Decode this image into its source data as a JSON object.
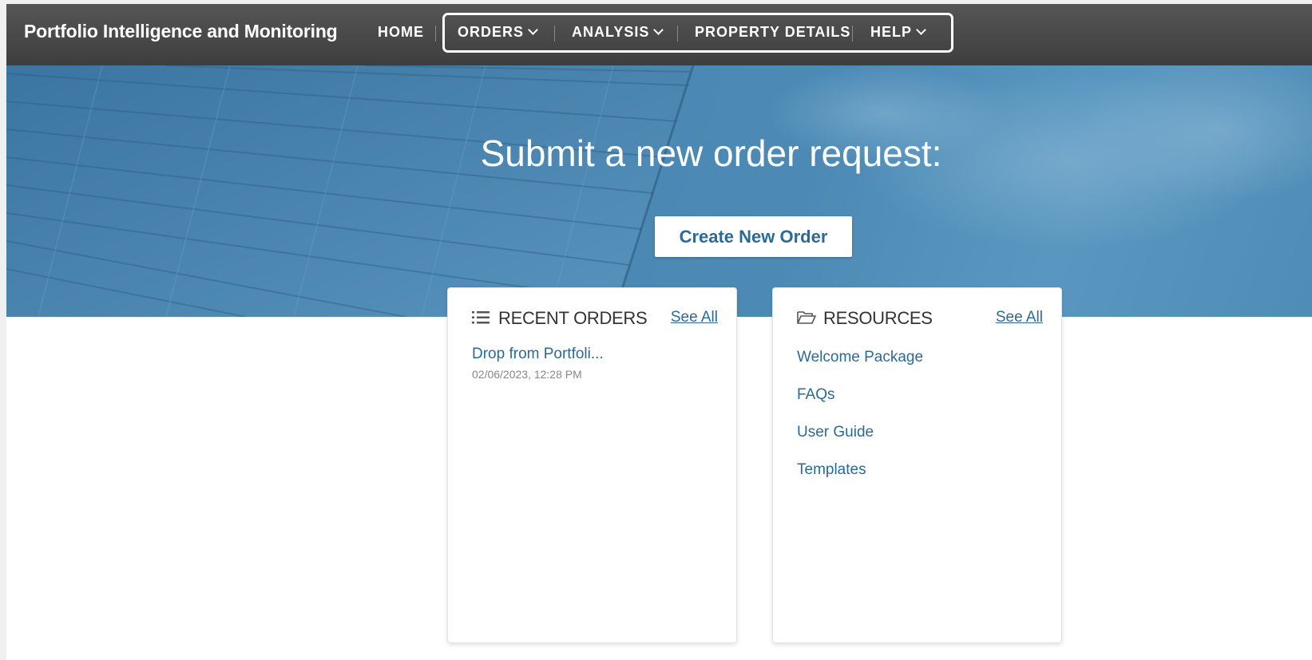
{
  "header": {
    "app_title": "Portfolio Intelligence and Monitoring",
    "home": "HOME",
    "nav": [
      {
        "label": "ORDERS",
        "dropdown": true
      },
      {
        "label": "ANALYSIS",
        "dropdown": true
      },
      {
        "label": "PROPERTY DETAILS",
        "dropdown": false
      },
      {
        "label": "HELP",
        "dropdown": true
      }
    ]
  },
  "hero": {
    "title": "Submit a new order request:",
    "button": "Create New Order"
  },
  "recent_orders": {
    "title": "RECENT ORDERS",
    "see_all": "See All",
    "items": [
      {
        "name": "Drop from Portfoli...",
        "date": "02/06/2023, 12:28 PM"
      }
    ]
  },
  "resources": {
    "title": "RESOURCES",
    "see_all": "See All",
    "items": [
      "Welcome Package",
      "FAQs",
      "User Guide",
      "Templates"
    ]
  },
  "colors": {
    "nav_bg": "#474747",
    "hero_blue": "#4a86b0",
    "link_blue": "#2a6a99"
  }
}
